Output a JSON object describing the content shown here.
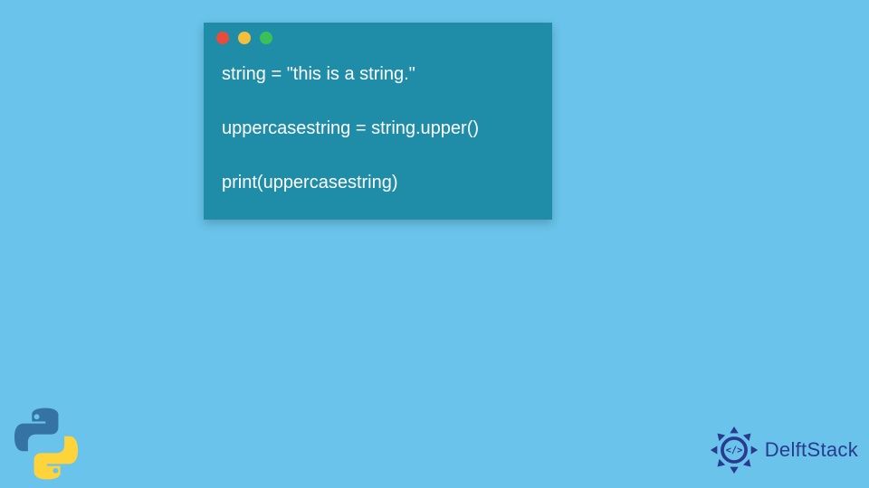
{
  "code_window": {
    "dots": [
      "#e94b3c",
      "#f4bf3a",
      "#3bbf58"
    ],
    "lines": [
      "string = \"this is a string.\"",
      "",
      "uppercasestring = string.upper()",
      "",
      "print(uppercasestring)"
    ]
  },
  "logos": {
    "python_alt": "python-logo",
    "delft_text": "DelftStack"
  },
  "colors": {
    "background": "#69c3ea",
    "window": "#1f8ca8",
    "code_text": "#ffffff",
    "delft_brand": "#2a3b8f"
  }
}
